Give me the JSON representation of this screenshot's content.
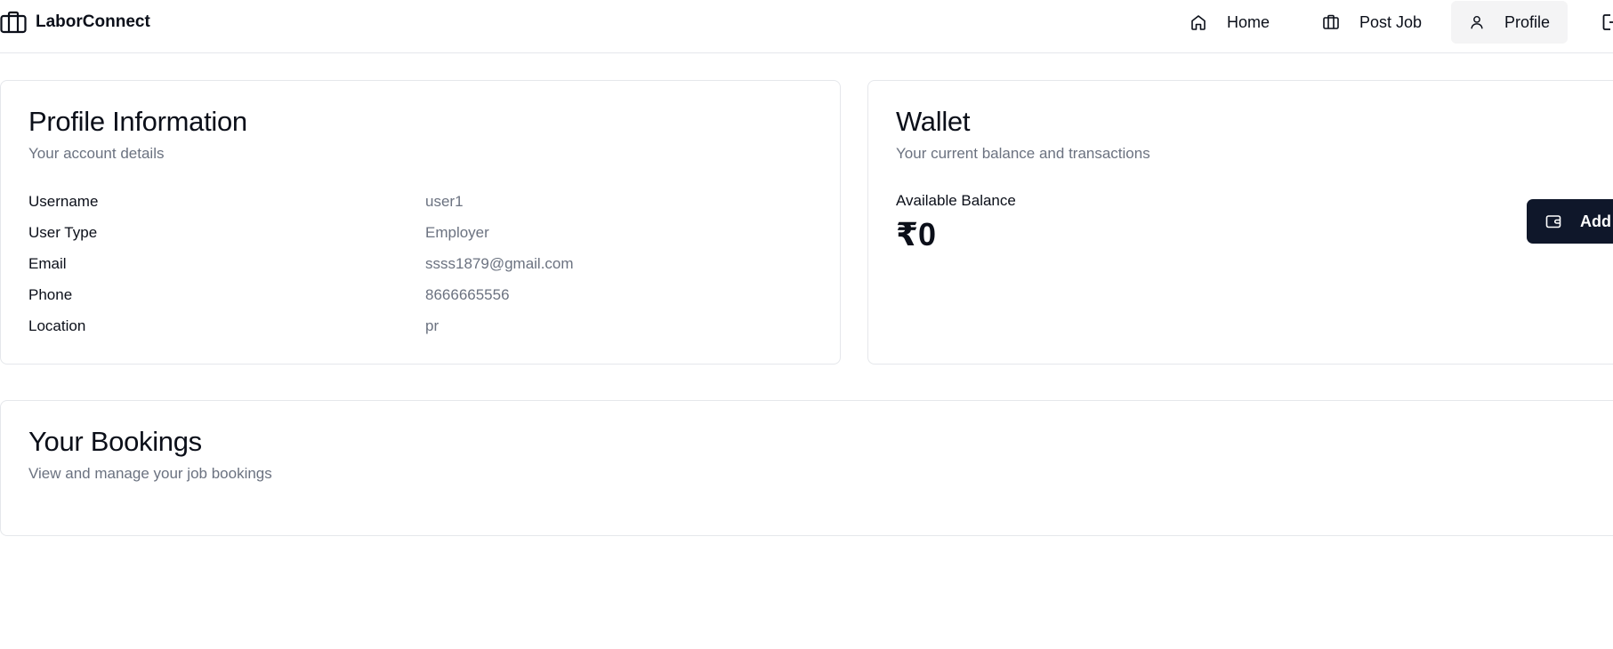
{
  "header": {
    "brand": "LaborConnect",
    "brand_icon": "briefcase-icon",
    "nav": [
      {
        "label": "Home",
        "icon": "home-icon"
      },
      {
        "label": "Post Job",
        "icon": "briefcase-icon"
      },
      {
        "label": "Profile",
        "icon": "user-icon",
        "active": true
      }
    ],
    "logout_icon": "logout-icon"
  },
  "profile": {
    "title": "Profile Information",
    "subtitle": "Your account details",
    "fields": [
      {
        "label": "Username",
        "value": "user1"
      },
      {
        "label": "User Type",
        "value": "Employer"
      },
      {
        "label": "Email",
        "value": "ssss1879@gmail.com"
      },
      {
        "label": "Phone",
        "value": "8666665556"
      },
      {
        "label": "Location",
        "value": "pr"
      }
    ]
  },
  "wallet": {
    "title": "Wallet",
    "subtitle": "Your current balance and transactions",
    "balance_label": "Available Balance",
    "balance_value": "₹0",
    "add_button_label": "Add",
    "add_button_icon": "wallet-icon"
  },
  "bookings": {
    "title": "Your Bookings",
    "subtitle": "View and manage your job bookings"
  },
  "colors": {
    "primary": "#0f172a",
    "muted_text": "#6b7280",
    "border": "#e5e7eb",
    "active_nav_bg": "#f4f4f5"
  }
}
